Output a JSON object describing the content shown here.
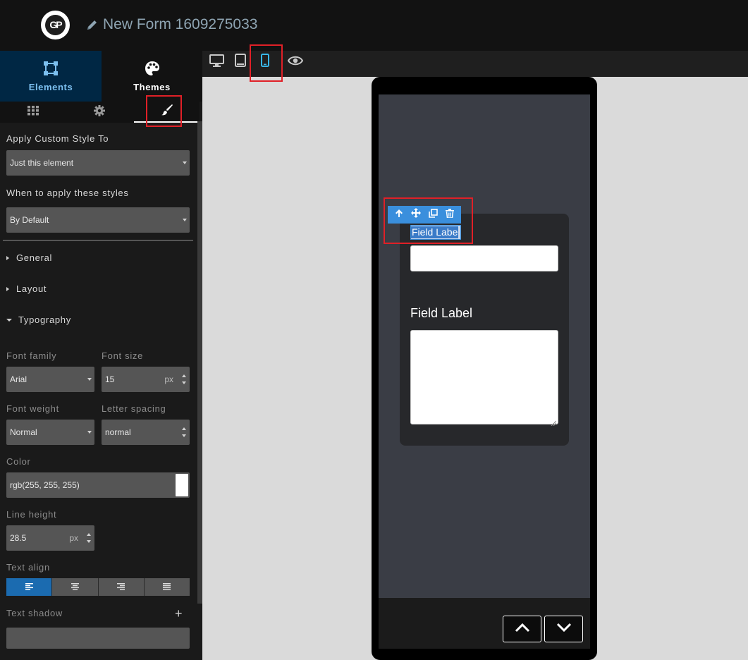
{
  "header": {
    "logo_text": "GP",
    "form_title": "New Form 1609275033"
  },
  "sidebar": {
    "main_tabs": [
      {
        "label": "Elements",
        "icon": "elements-icon",
        "active": true
      },
      {
        "label": "Themes",
        "icon": "palette-icon",
        "active": false
      }
    ],
    "sub_tabs": [
      {
        "icon": "grid-icon",
        "active": false
      },
      {
        "icon": "gear-icon",
        "active": false
      },
      {
        "icon": "paintbrush-icon",
        "active": true
      }
    ],
    "apply_style_label": "Apply Custom Style To",
    "apply_style_value": "Just this element",
    "when_label": "When to apply these styles",
    "when_value": "By Default",
    "sections": {
      "general": "General",
      "layout": "Layout",
      "typography": "Typography"
    },
    "typography": {
      "font_family_label": "Font family",
      "font_family_value": "Arial",
      "font_size_label": "Font size",
      "font_size_value": "15",
      "font_size_unit": "px",
      "font_weight_label": "Font weight",
      "font_weight_value": "Normal",
      "letter_spacing_label": "Letter spacing",
      "letter_spacing_value": "normal",
      "color_label": "Color",
      "color_value": "rgb(255, 255, 255)",
      "line_height_label": "Line height",
      "line_height_value": "28.5",
      "line_height_unit": "px",
      "text_align_label": "Text align",
      "text_align_options": [
        "left",
        "center",
        "right",
        "justify"
      ],
      "text_align_selected": "left",
      "text_shadow_label": "Text shadow",
      "add_shadow_glyph": "+"
    }
  },
  "device_toolbar": {
    "devices": [
      "desktop",
      "tablet",
      "mobile"
    ],
    "selected": "mobile",
    "preview_icon": "eye-icon"
  },
  "preview": {
    "selected_field_label": "Field Labe",
    "second_field_label": "Field Label",
    "element_toolbar": [
      "arrow-up-icon",
      "move-icon",
      "copy-icon",
      "trash-icon"
    ],
    "nav_buttons": [
      "chevron-up-icon",
      "chevron-down-icon"
    ]
  },
  "colors": {
    "accent": "#3a8fdd",
    "highlight_red": "#e02027",
    "active_tab_bg": "#002744",
    "mobile_icon": "#38b6e8"
  }
}
